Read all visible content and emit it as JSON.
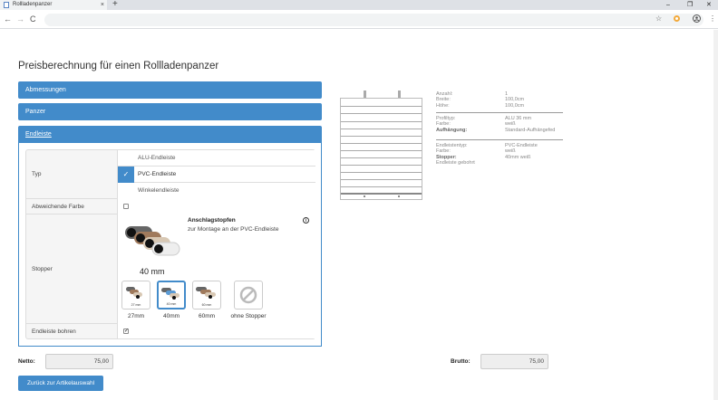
{
  "browser": {
    "tab_title": "Rollladenpanzer",
    "tab_close": "×",
    "new_tab": "+",
    "minimize": "–",
    "maximize": "❐",
    "close": "✕",
    "back": "←",
    "forward": "→",
    "reload": "C",
    "star": "☆",
    "menu": "⋮"
  },
  "page": {
    "title": "Preisberechnung für einen Rollladenpanzer"
  },
  "accordion": [
    {
      "label": "Abmessungen"
    },
    {
      "label": "Panzer"
    },
    {
      "label": "Endleiste"
    }
  ],
  "form": {
    "typ_label": "Typ",
    "typ_options": [
      "ALU-Endleiste",
      "PVC-Endleiste",
      "Winkelendleiste"
    ],
    "typ_selected_index": 1,
    "farbe_label": "Abweichende Farbe",
    "farbe_checked": false,
    "stopper_label": "Stopper",
    "stopper_title": "Anschlagstopfen",
    "stopper_desc": "zur Montage an der PVC-Endleiste",
    "stopper_size": "40 mm",
    "stopper_options": [
      {
        "thumb": "27 mm",
        "caption": "27mm"
      },
      {
        "thumb": "40 mm",
        "caption": "40mm"
      },
      {
        "thumb": "60 mm",
        "caption": "60mm"
      },
      {
        "thumb": "",
        "caption": "ohne Stopper"
      }
    ],
    "stopper_selected_index": 1,
    "bohren_label": "Endleiste bohren",
    "bohren_checked": true
  },
  "totals": {
    "netto_label": "Netto:",
    "netto_value": "75,00",
    "brutto_label": "Brutto:",
    "brutto_value": "75,00"
  },
  "back_button": "Zurück zur Artikelauswahl",
  "summary": {
    "group1": [
      {
        "k": "Anzahl:",
        "v": "1"
      },
      {
        "k": "Breite:",
        "v": "100,0cm"
      },
      {
        "k": "Höhe:",
        "v": "100,0cm"
      }
    ],
    "group2": [
      {
        "k": "Profiltyp:",
        "v": "ALU 36 mm"
      },
      {
        "k": "Farbe:",
        "v": "weiß"
      },
      {
        "k": "Aufhängung:",
        "v": "Standard-Aufhängefed"
      }
    ],
    "group3": [
      {
        "k": "Endleistentyp:",
        "v": "PVC-Endleiste"
      },
      {
        "k": "Farbe:",
        "v": "weiß"
      },
      {
        "k": "Stopper:",
        "v": "40mm weiß"
      },
      {
        "k": "Endleiste gebohrt",
        "v": ""
      }
    ]
  },
  "colors": {
    "accent": "#428bca"
  }
}
